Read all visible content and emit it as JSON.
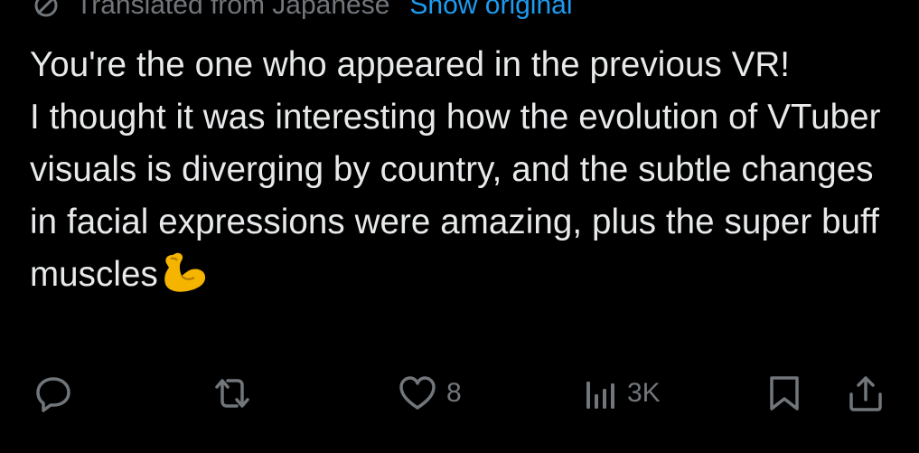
{
  "translation": {
    "icon": "translate-icon",
    "label": "Translated from Japanese",
    "show_original_label": "Show original"
  },
  "post": {
    "paragraphs": [
      "You're the one who appeared in the previous VR!",
      "I thought it was interesting how the evolution of VTuber visuals is diverging by country, and the subtle changes in facial expressions were amazing, plus the super buff muscles"
    ],
    "emoji": "flexed-biceps"
  },
  "actions": {
    "reply": {
      "icon": "reply-icon",
      "count": ""
    },
    "repost": {
      "icon": "repost-icon",
      "count": ""
    },
    "like": {
      "icon": "heart-icon",
      "count": "8"
    },
    "views": {
      "icon": "views-icon",
      "count": "3K"
    },
    "bookmark": {
      "icon": "bookmark-icon"
    },
    "share": {
      "icon": "share-icon"
    }
  },
  "colors": {
    "background": "#000000",
    "text": "#e7e9ea",
    "muted": "#71767b",
    "link": "#1d9bf0",
    "emoji": "#f4b400"
  }
}
